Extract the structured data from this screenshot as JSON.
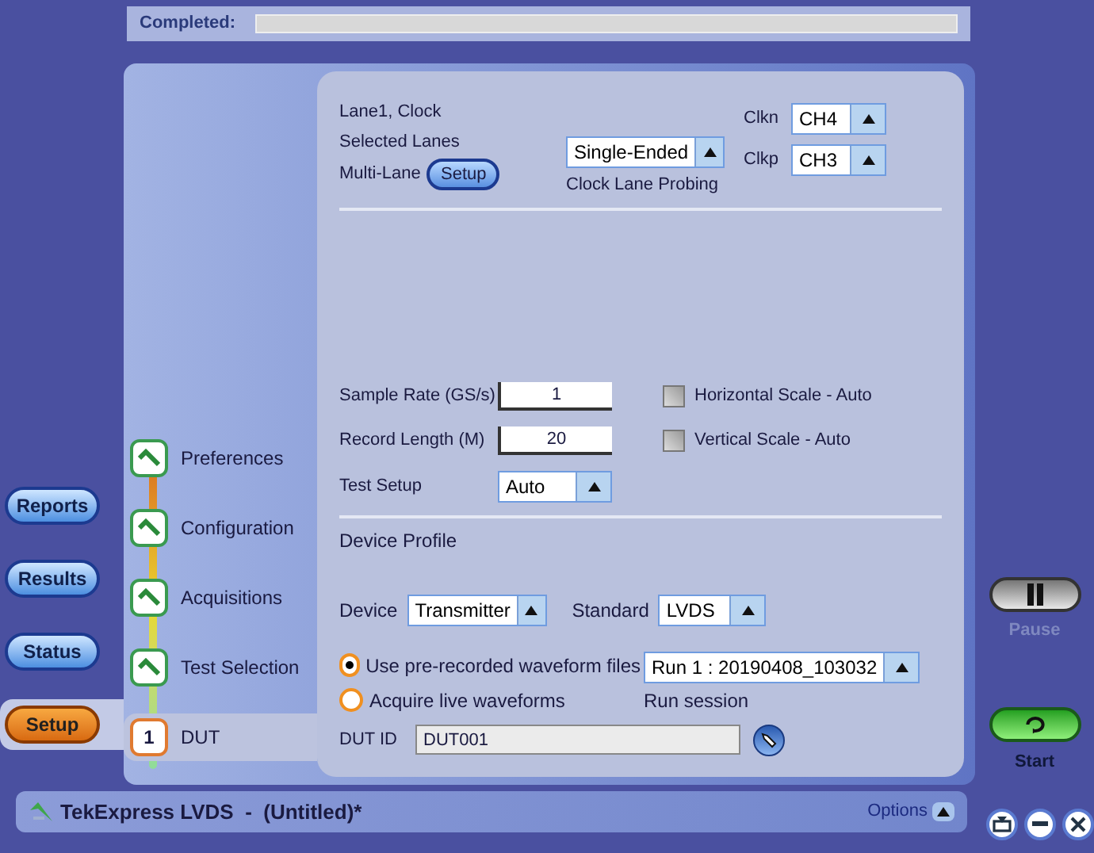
{
  "status_bar": {
    "label": "Completed:",
    "level": 0
  },
  "clock": {
    "selected_lanes": "Lane1, Clock",
    "selected_lanes_label": "Selected Lanes",
    "multi_lane": "Multi-Lane",
    "setup_button": "Setup",
    "probing": "Single-Ended",
    "probing_label": "Clock Lane Probing",
    "channels": [
      {
        "label": "Clkn",
        "value": "CH4"
      },
      {
        "label": "Clkp",
        "value": "CH3"
      }
    ]
  },
  "device_profile": {
    "sample_rate": {
      "label": "Sample Rate (GS/s)",
      "value": "1"
    },
    "record_length": {
      "label": "Record Length (M)",
      "value": "20"
    },
    "scales": [
      {
        "label": "Horizontal Scale - Auto",
        "checked": false
      },
      {
        "label": "Vertical Scale - Auto",
        "checked": false
      }
    ],
    "test_setup": {
      "label": "Test Setup",
      "value": "Auto"
    },
    "title": "Device Profile"
  },
  "steps": [
    {
      "label": "Preferences",
      "selected": false,
      "done": true
    },
    {
      "label": "Configuration",
      "selected": false,
      "done": true
    },
    {
      "label": "Acquisitions",
      "selected": false,
      "done": true
    },
    {
      "label": "Test Selection",
      "selected": false,
      "done": true
    },
    {
      "label": "DUT",
      "number": "1",
      "selected": true,
      "done": false
    }
  ],
  "nav_tabs": [
    {
      "label": "Reports",
      "selected": false
    },
    {
      "label": "Results",
      "selected": false
    },
    {
      "label": "Status",
      "selected": false
    },
    {
      "label": "Setup",
      "selected": true
    }
  ],
  "device": {
    "label": "Device",
    "value": "Transmitter"
  },
  "standard": {
    "label": "Standard",
    "value": "LVDS"
  },
  "actions": [
    {
      "kind": "pause",
      "label": "Pause",
      "disabled": true
    },
    {
      "kind": "start",
      "label": "Start",
      "disabled": false
    }
  ],
  "waveform_source": [
    {
      "label": "Use pre-recorded waveform files",
      "selected": true
    },
    {
      "label": "Acquire live waveforms",
      "selected": false
    }
  ],
  "run_session": {
    "label": "Run session",
    "value": "Run 1 : 20190408_103032"
  },
  "dut_id": {
    "label": "DUT ID",
    "value": "DUT001"
  },
  "title_bar": {
    "title": "TekExpress LVDS  -  (Untitled)*",
    "options": "Options"
  }
}
